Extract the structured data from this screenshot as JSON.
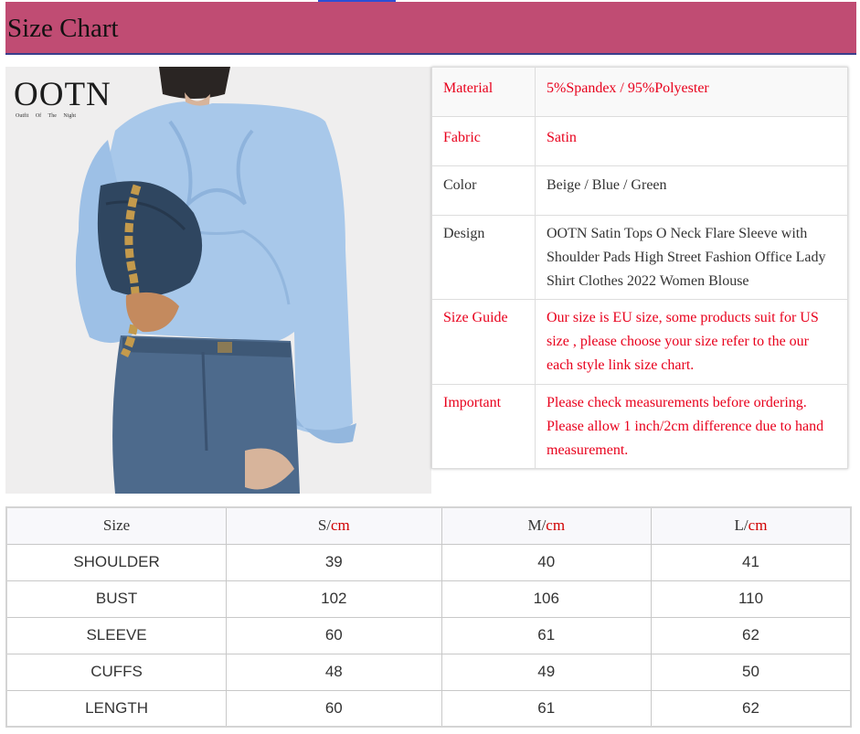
{
  "header": {
    "title": "Size Chart"
  },
  "product_image": {
    "brand_name": "OOTN",
    "brand_tagline": "Outfit Of The Night"
  },
  "specs": [
    {
      "key": "Material",
      "value": "5%Spandex / 95%Polyester",
      "emphasis": "red"
    },
    {
      "key": "Fabric",
      "value": "Satin",
      "emphasis": "red"
    },
    {
      "key": "Color",
      "value": "Beige / Blue / Green",
      "emphasis": "normal"
    },
    {
      "key": "Design",
      "value": "OOTN Satin Tops O Neck Flare Sleeve with Shoulder Pads High Street Fashion Office Lady Shirt Clothes 2022 Women Blouse",
      "emphasis": "normal"
    },
    {
      "key": "Size Guide",
      "value": "Our size is EU size, some products suit for US size , please choose your size refer to the our each style link size chart.",
      "emphasis": "red"
    },
    {
      "key": "Important",
      "value": "Please check measurements before ordering. Please allow 1 inch/2cm difference due to hand measurement.",
      "emphasis": "red"
    }
  ],
  "size_table": {
    "headers": [
      {
        "size": "Size",
        "unit": ""
      },
      {
        "size": "S/",
        "unit": "cm"
      },
      {
        "size": "M/",
        "unit": "cm"
      },
      {
        "size": "L/",
        "unit": "cm"
      }
    ],
    "rows": [
      [
        "SHOULDER",
        "39",
        "40",
        "41"
      ],
      [
        "BUST",
        "102",
        "106",
        "110"
      ],
      [
        "SLEEVE",
        "60",
        "61",
        "62"
      ],
      [
        "CUFFS",
        "48",
        "49",
        "50"
      ],
      [
        "LENGTH",
        "60",
        "61",
        "62"
      ]
    ]
  },
  "colors": {
    "header_bg": "#c04c73",
    "header_rule": "#3a3e8c",
    "accent_red": "#e8001c",
    "blouse_blue": "#a8c8ea",
    "denim": "#3e5876"
  }
}
